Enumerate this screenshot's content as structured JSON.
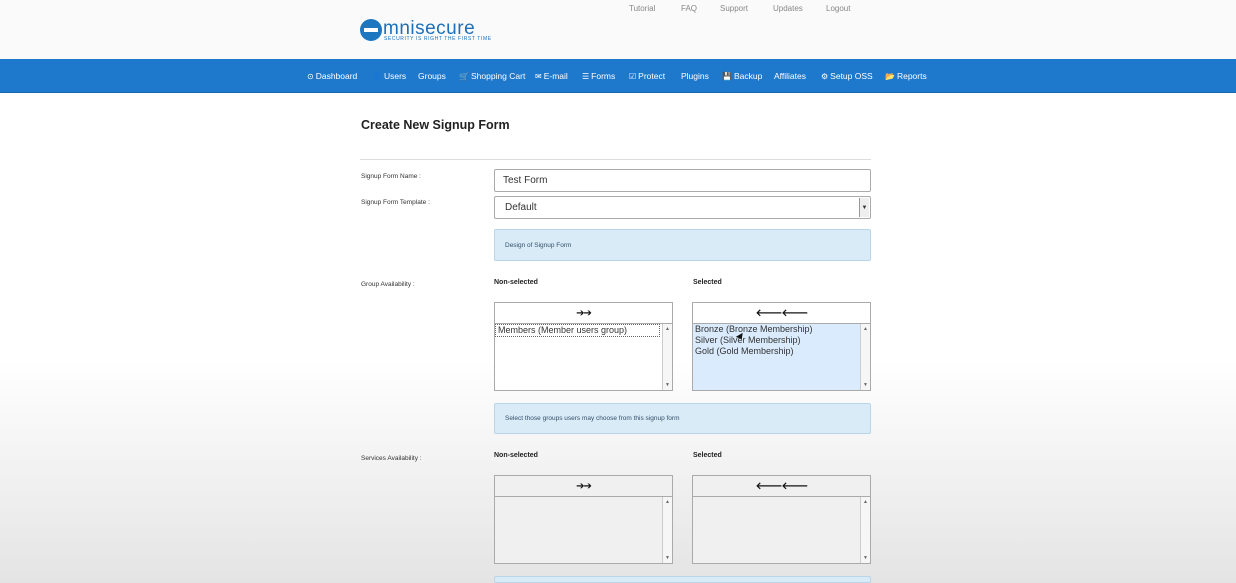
{
  "brand": {
    "logo_text": "mnisecure",
    "tagline": "Security is right the first time"
  },
  "toplinks": [
    "Tutorial",
    "FAQ",
    "Support",
    "Updates",
    "Logout"
  ],
  "nav": [
    {
      "label": "Dashboard",
      "icon": "⊙"
    },
    {
      "label": "Users",
      "icon": "👤"
    },
    {
      "label": "Groups",
      "icon": ""
    },
    {
      "label": "Shopping Cart",
      "icon": "🛒"
    },
    {
      "label": "E-mail",
      "icon": "✉"
    },
    {
      "label": "Forms",
      "icon": "☰"
    },
    {
      "label": "Protect",
      "icon": "☑"
    },
    {
      "label": "Plugins",
      "icon": ""
    },
    {
      "label": "Backup",
      "icon": "💾"
    },
    {
      "label": "Affiliates",
      "icon": ""
    },
    {
      "label": "Setup OSS",
      "icon": "⚙"
    },
    {
      "label": "Reports",
      "icon": "📂"
    }
  ],
  "page": {
    "title": "Create New Signup Form"
  },
  "form": {
    "name_label": "Signup Form Name :",
    "name_value": "Test Form",
    "template_label": "Signup Form Template :",
    "template_value": "Default",
    "template_hint": "Design of Signup Form",
    "group_label": "Group Availability :",
    "group_nonselected_head": "Non-selected",
    "group_selected_head": "Selected",
    "group_nonselected": [
      "Members (Member users group)"
    ],
    "group_selected": [
      "Bronze (Bronze Membership)",
      "Silver (Silver Membership)",
      "Gold (Gold Membership)"
    ],
    "group_hint": "Select those groups users may choose from this signup form",
    "services_label": "Services Availability :",
    "services_nonselected_head": "Non-selected",
    "services_selected_head": "Selected",
    "move_right": "➔➔",
    "move_left": "🡐🡐"
  }
}
